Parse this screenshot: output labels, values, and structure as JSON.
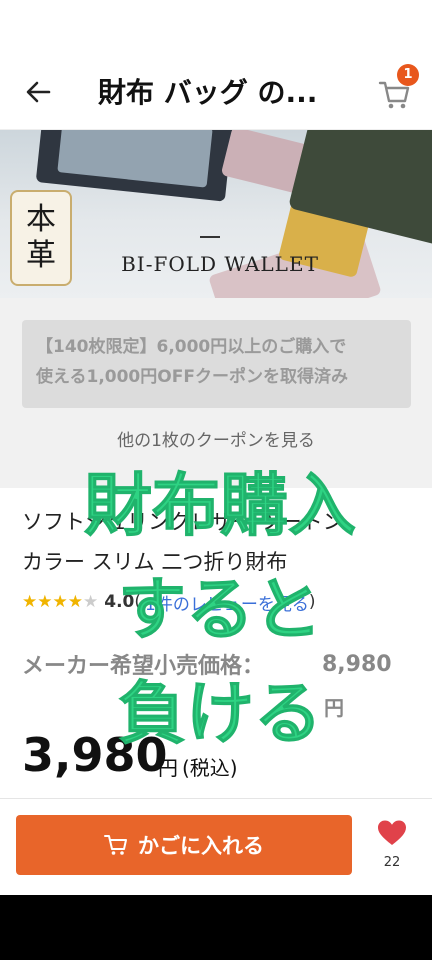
{
  "header": {
    "title": "財布 バッグ の...",
    "cart_badge": "1"
  },
  "banner": {
    "seal_char1": "本",
    "seal_char2": "革",
    "headline": "BI-FOLD WALLET"
  },
  "coupon": {
    "line1": "【140枚限定】6,000円以上のご購入で",
    "line2": "使える1,000円OFFクーポンを取得済み",
    "more_link": "他の1枚のクーポンを見る"
  },
  "product": {
    "name_line1": "ソフトシュリンクレザー ツートン",
    "name_line2": "カラー スリム 二つ折り財布",
    "rating": "4.0",
    "stars_filled": 4,
    "stars_total": 5,
    "review_link": "1件のレビューを見る",
    "paren_open": "(",
    "paren_close": ")",
    "msrp_label": "メーカー希望小売価格：",
    "msrp_value": "8,980",
    "msrp_unit": "円",
    "price": "3,980",
    "price_unit": "円",
    "tax_label": "(税込)"
  },
  "overlay": {
    "line1": "財布購入",
    "line2": "すると",
    "line3": "負ける"
  },
  "actions": {
    "add_to_cart": "かごに入れる",
    "favorite_count": "22"
  },
  "colors": {
    "accent": "#e8652a",
    "overlay_text": "#2ed383",
    "link": "#3a6fd8",
    "star": "#f0b400"
  }
}
